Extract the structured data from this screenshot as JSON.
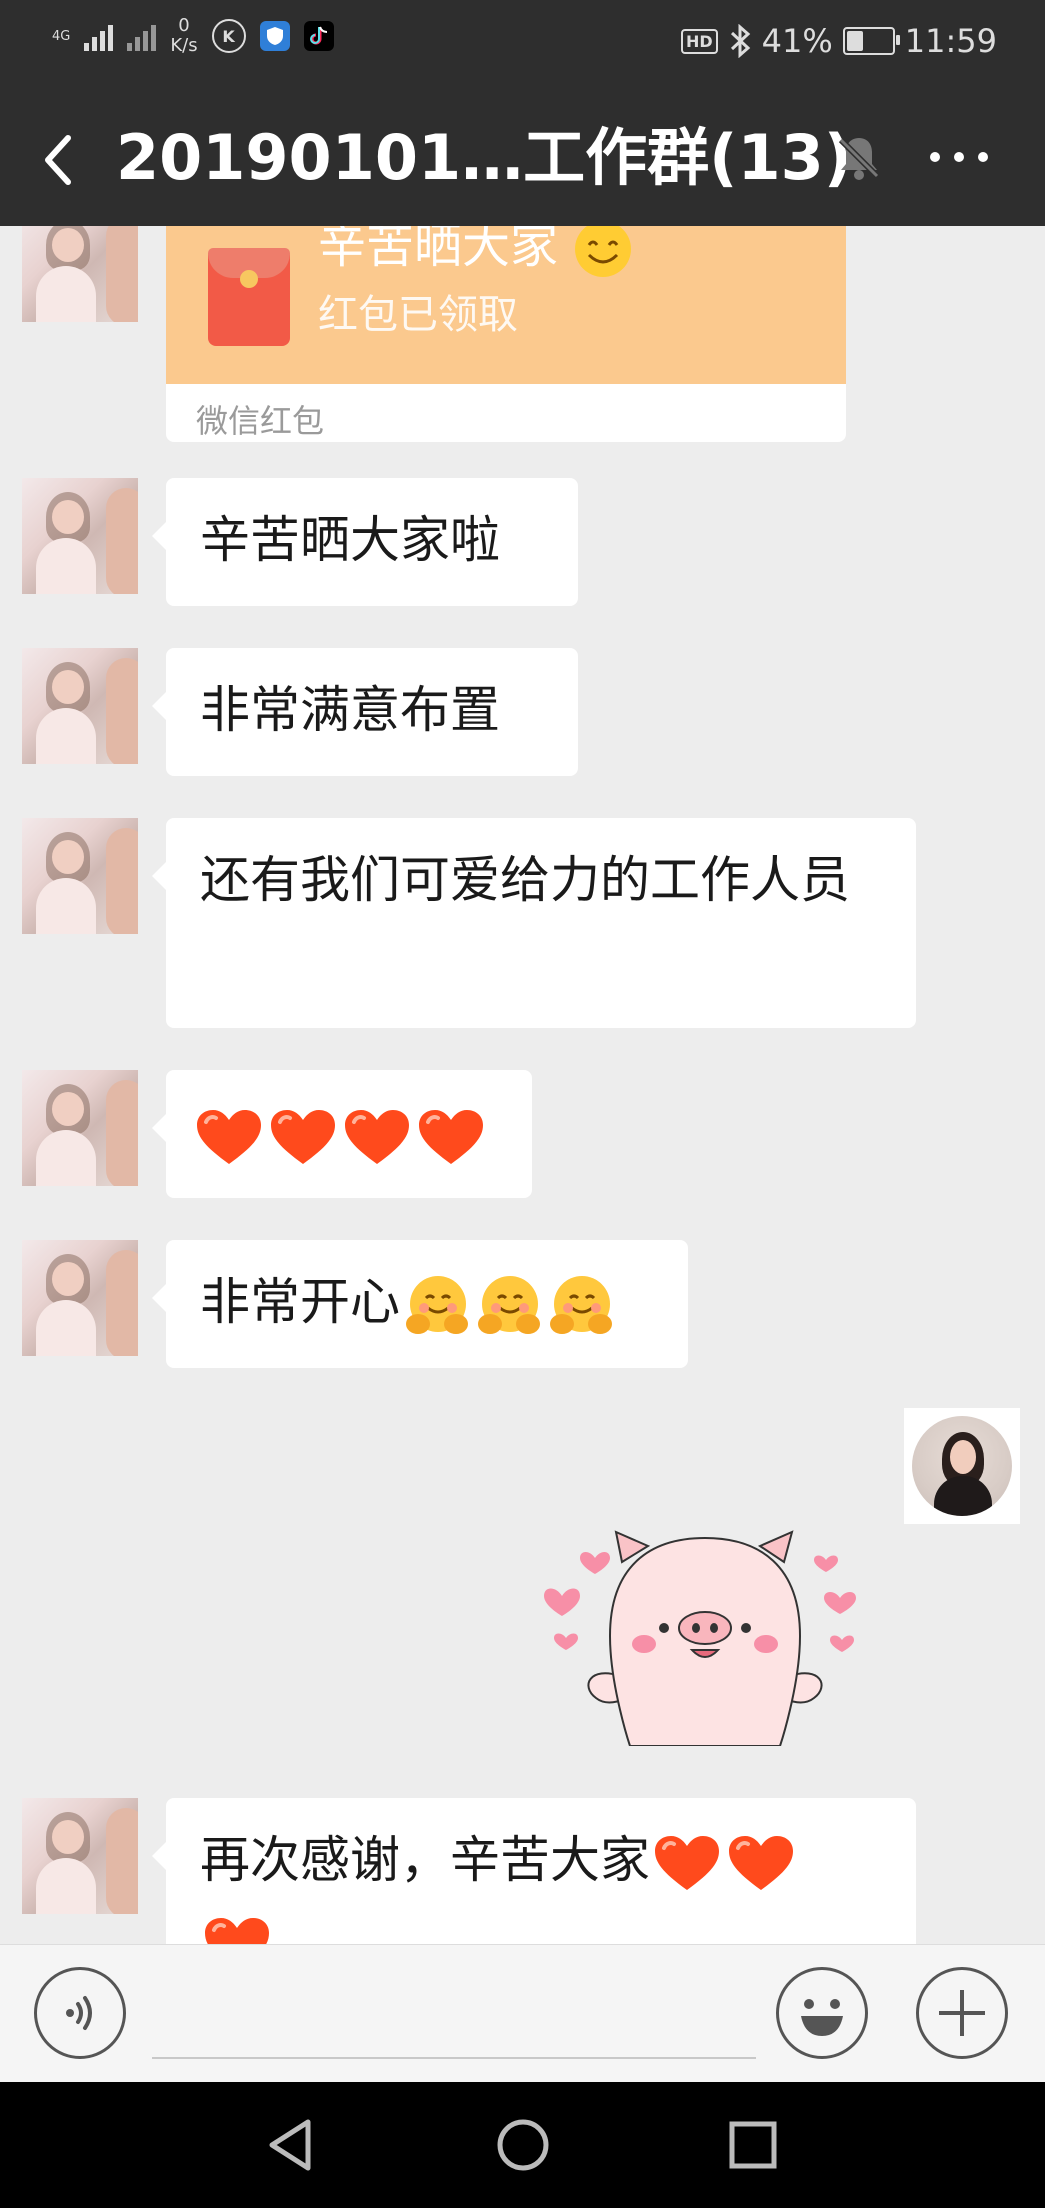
{
  "status_bar": {
    "network_type": "4G",
    "net_speed_value": "0",
    "net_speed_unit": "K/s",
    "hd_label": "HD",
    "battery_text": "41%",
    "battery_level": 0.41,
    "time": "11:59"
  },
  "header": {
    "title": "20190101…工作群(13)"
  },
  "red_packet": {
    "greeting": "辛苦晒大家",
    "status": "红包已领取",
    "footer": "微信红包",
    "accent_color": "#fbc98e"
  },
  "messages": [
    {
      "text": "辛苦晒大家啦"
    },
    {
      "text": "非常满意布置"
    },
    {
      "text": "还有我们可爱给力的工作人员"
    },
    {
      "text": "非常开心"
    },
    {
      "text": "再次感谢，辛苦大家"
    }
  ],
  "colors": {
    "header_bg": "#2e2e2e",
    "chat_bg": "#ededed",
    "bubble_bg": "#ffffff",
    "heart": "#ff4a1c"
  }
}
